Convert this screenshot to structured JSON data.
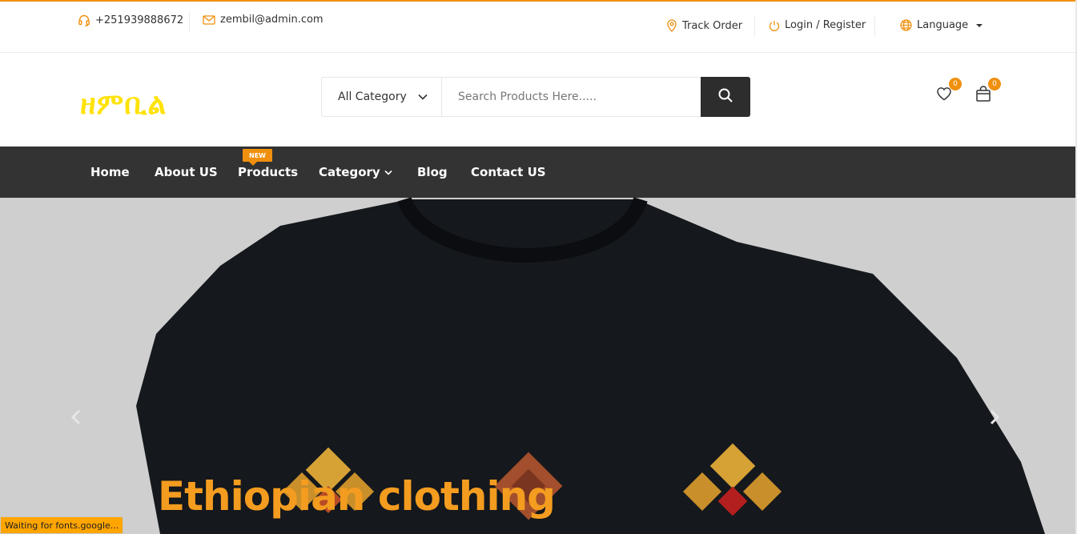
{
  "colors": {
    "accent": "#f0900e",
    "logo": "#ffe20a",
    "nav_bg": "#333333",
    "search_button_bg": "#2d2d2d",
    "hero_title": "#f39c1f",
    "status_bg": "#ffa500"
  },
  "topbar": {
    "phone": "+251939888672",
    "phone_icon": "headset-icon",
    "email": "zembil@admin.com",
    "email_icon": "envelope-icon",
    "track_order": "Track Order",
    "track_icon": "map-pin-icon",
    "login_register": "Login / Register",
    "login_icon": "power-icon",
    "language": "Language",
    "language_icon": "globe-icon"
  },
  "header": {
    "logo_text": "ዘምቢል",
    "category_select": "All Category",
    "search_placeholder": "Search Products Here.....",
    "search_icon": "search-icon",
    "wishlist_count": "0",
    "cart_count": "0"
  },
  "nav": {
    "items": [
      "Home",
      "About US",
      "Products",
      "Category",
      "Blog",
      "Contact US"
    ],
    "new_badge": "NEW"
  },
  "hero": {
    "title": "Ethiopian clothing"
  },
  "status_bar": {
    "text": "Waiting for fonts.google..."
  }
}
